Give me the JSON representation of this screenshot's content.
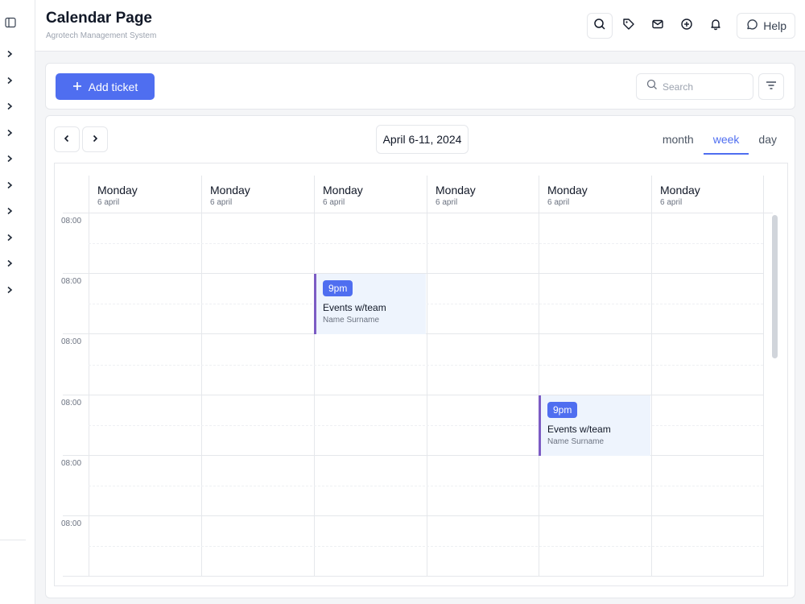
{
  "header": {
    "title": "Calendar Page",
    "subtitle": "Agrotech Management System",
    "help_label": "Help"
  },
  "toolbar": {
    "add_label": "Add ticket",
    "search_placeholder": "Search"
  },
  "calendar": {
    "date_range": "April 6-11, 2024",
    "views": [
      "month",
      "week",
      "day"
    ],
    "active_view": "week",
    "columns": [
      {
        "day": "Monday",
        "date": "6 april"
      },
      {
        "day": "Monday",
        "date": "6 april"
      },
      {
        "day": "Monday",
        "date": "6 april"
      },
      {
        "day": "Monday",
        "date": "6 april"
      },
      {
        "day": "Monday",
        "date": "6 april"
      },
      {
        "day": "Monday",
        "date": "6 april"
      }
    ],
    "times": [
      "08:00",
      "08:00",
      "08:00",
      "08:00",
      "08:00",
      "08:00"
    ],
    "events": [
      {
        "time": "9pm",
        "title": "Events w/team",
        "person": "Name Surname"
      },
      {
        "time": "9pm",
        "title": "Events w/team",
        "person": "Name Surname"
      }
    ]
  },
  "colors": {
    "accent": "#4f6ef0",
    "event_bg": "#eef4fd",
    "event_border": "#7c5cc4"
  },
  "icons": {
    "rail_top": "sidebar-panel-icon",
    "rail_items": "chevron-right-icon",
    "header": [
      "search-icon",
      "tag-icon",
      "mail-icon",
      "plus-circle-icon",
      "bell-icon",
      "chat-icon"
    ]
  }
}
